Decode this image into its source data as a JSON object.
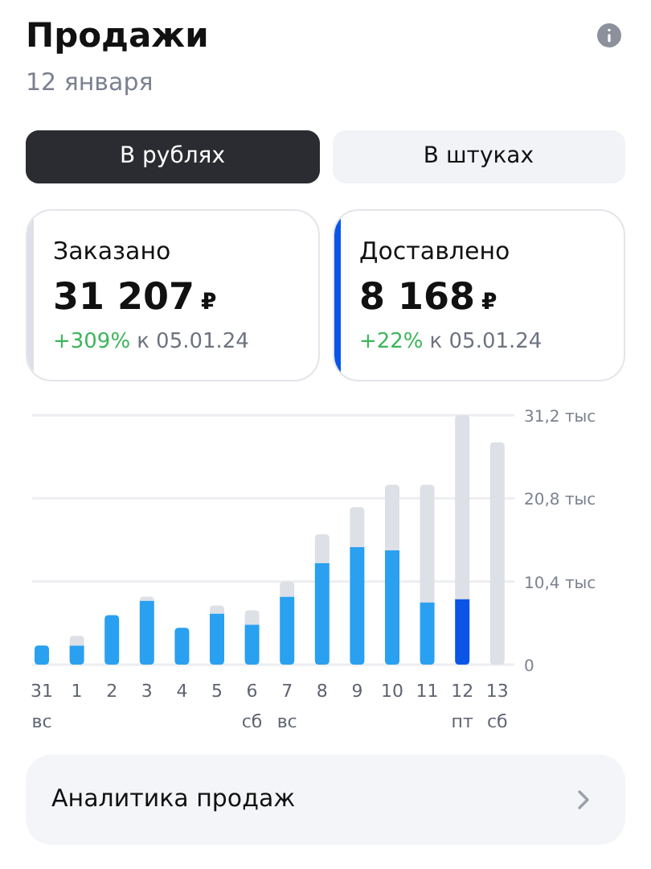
{
  "header": {
    "title": "Продажи",
    "date": "12 января"
  },
  "tabs": [
    {
      "label": "В рублях",
      "selected": true
    },
    {
      "label": "В штуках",
      "selected": false
    }
  ],
  "cards": [
    {
      "label": "Заказано",
      "value": "31 207",
      "currency": "₽",
      "change": "+309%",
      "compare": "к 05.01.24",
      "color": "#dde0e6"
    },
    {
      "label": "Доставлено",
      "value": "8 168",
      "currency": "₽",
      "change": "+22%",
      "compare": "к 05.01.24",
      "color": "#0a55e6"
    }
  ],
  "chart": {
    "chart_data": {
      "type": "bar",
      "categories": [
        "31\nвс",
        "1",
        "2",
        "3",
        "4",
        "5",
        "6\nсб",
        "7\nвс",
        "8",
        "9",
        "10",
        "11",
        "12\nпт",
        "13\nсб"
      ],
      "stacked": true,
      "series": [
        {
          "color": "#2aa0f0",
          "values": [
            2.4,
            2.4,
            6.2,
            8.0,
            4.6,
            6.4,
            5.0,
            8.5,
            12.7,
            14.7,
            14.3,
            7.8,
            null,
            null
          ]
        },
        {
          "color": "#0a55e6",
          "values": [
            null,
            null,
            null,
            null,
            null,
            null,
            null,
            null,
            null,
            null,
            null,
            null,
            8.2,
            null
          ]
        },
        {
          "color": "#dde0e6",
          "values": [
            0,
            1.2,
            0,
            0.5,
            0,
            1.0,
            1.8,
            1.9,
            3.6,
            5.0,
            8.2,
            14.7,
            23.0,
            27.8
          ]
        }
      ],
      "ylim": [
        0,
        31.2
      ],
      "yticks": [
        {
          "value": 0,
          "label": "0"
        },
        {
          "value": 10.4,
          "label": "10,4 тыс"
        },
        {
          "value": 20.8,
          "label": "20,8 тыс"
        },
        {
          "value": 31.2,
          "label": "31,2 тыс"
        }
      ]
    }
  },
  "analytics_link": {
    "label": "Аналитика продаж"
  }
}
